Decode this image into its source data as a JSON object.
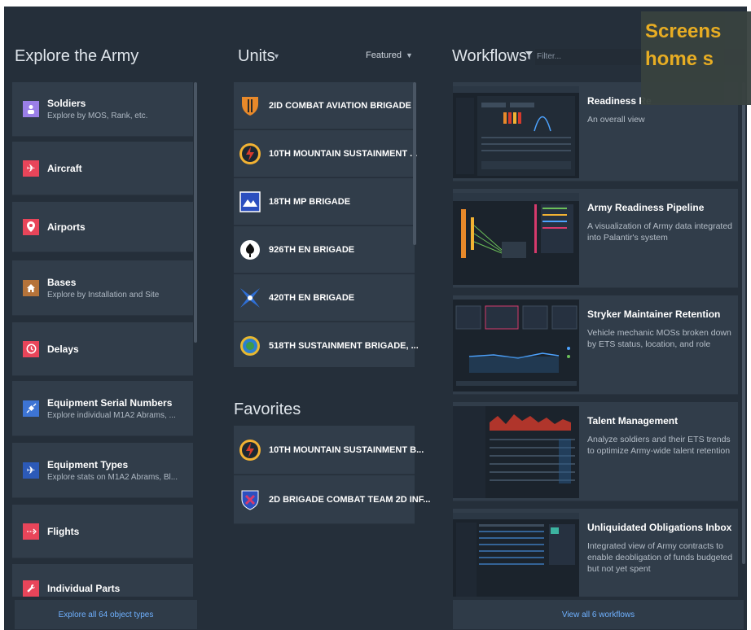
{
  "explore": {
    "title": "Explore the Army",
    "footer": "Explore all 64 object types",
    "items": [
      {
        "title": "Soldiers",
        "subtitle": "Explore by MOS, Rank, etc.",
        "icon": "person-icon",
        "color": "#9b7fe8",
        "glyph": "♟"
      },
      {
        "title": "Aircraft",
        "subtitle": "",
        "icon": "airplane-icon",
        "color": "#e8455a",
        "glyph": "✈"
      },
      {
        "title": "Airports",
        "subtitle": "",
        "icon": "map-pin-icon",
        "color": "#e8455a",
        "glyph": "◉"
      },
      {
        "title": "Bases",
        "subtitle": "Explore by Installation and Site",
        "icon": "home-icon",
        "color": "#b5733a",
        "glyph": "⌂"
      },
      {
        "title": "Delays",
        "subtitle": "",
        "icon": "clock-icon",
        "color": "#e8455a",
        "glyph": "◷"
      },
      {
        "title": "Equipment Serial Numbers",
        "subtitle": "Explore individual M1A2 Abrams, ...",
        "icon": "satellite-icon",
        "color": "#3d74d4",
        "glyph": "✶"
      },
      {
        "title": "Equipment Types",
        "subtitle": "Explore stats on M1A2 Abrams, Bl...",
        "icon": "airplane-icon",
        "color": "#2c5ab8",
        "glyph": "✈"
      },
      {
        "title": "Flights",
        "subtitle": "",
        "icon": "flight-path-icon",
        "color": "#e8455a",
        "glyph": "⇢"
      },
      {
        "title": "Individual Parts",
        "subtitle": "",
        "icon": "wrench-icon",
        "color": "#e8455a",
        "glyph": "⚒"
      }
    ]
  },
  "units": {
    "title": "Units",
    "sort_label": "Featured",
    "items": [
      {
        "name": "2ID COMBAT AVIATION BRIGADE",
        "icon": "aviation-brigade-insignia-icon",
        "colors": [
          "#e8892a",
          "#2a2a2a"
        ]
      },
      {
        "name": "10TH MOUNTAIN SUSTAINMENT ...",
        "icon": "mountain-sustainment-insignia-icon",
        "colors": [
          "#f2b233",
          "#d63a2c"
        ]
      },
      {
        "name": "18TH MP BRIGADE",
        "icon": "mp-brigade-insignia-icon",
        "colors": [
          "#2c4fbf",
          "#ffffff"
        ]
      },
      {
        "name": "926TH EN BRIGADE",
        "icon": "en-brigade-insignia-icon",
        "colors": [
          "#ffffff",
          "#111111"
        ]
      },
      {
        "name": "420TH EN BRIGADE",
        "icon": "en-brigade-star-insignia-icon",
        "colors": [
          "#2f6fd6",
          "#ffffff"
        ]
      },
      {
        "name": "518TH SUSTAINMENT BRIGADE, ...",
        "icon": "sustainment-brigade-insignia-icon",
        "colors": [
          "#e8b830",
          "#2a7fd0"
        ]
      }
    ]
  },
  "favorites": {
    "title": "Favorites",
    "items": [
      {
        "name": "10TH MOUNTAIN SUSTAINMENT B...",
        "icon": "mountain-sustainment-insignia-icon",
        "colors": [
          "#f2b233",
          "#d63a2c"
        ]
      },
      {
        "name": "2D BRIGADE COMBAT TEAM 2D INF...",
        "icon": "brigade-combat-team-insignia-icon",
        "colors": [
          "#2c4fbf",
          "#d63a6c"
        ]
      }
    ]
  },
  "workflows": {
    "title": "Workflows",
    "filter_placeholder": "Filter...",
    "footer": "View all 6 workflows",
    "items": [
      {
        "name": "Readiness Re",
        "desc": "An overall view"
      },
      {
        "name": "Army Readiness Pipeline",
        "desc": "A visualization of Army data integrated into Palantir's system"
      },
      {
        "name": "Stryker Maintainer Retention",
        "desc": "Vehicle mechanic MOSs broken down by ETS status, location, and role"
      },
      {
        "name": "Talent Management",
        "desc": "Analyze soldiers and their ETS trends to optimize Army-wide talent retention"
      },
      {
        "name": "Unliquidated Obligations Inbox",
        "desc": "Integrated view of Army contracts to enable deobligation of funds budgeted but not yet spent"
      }
    ]
  },
  "overlay": {
    "line1": "Screens",
    "line2": "home s",
    "color": "#f0b323"
  }
}
